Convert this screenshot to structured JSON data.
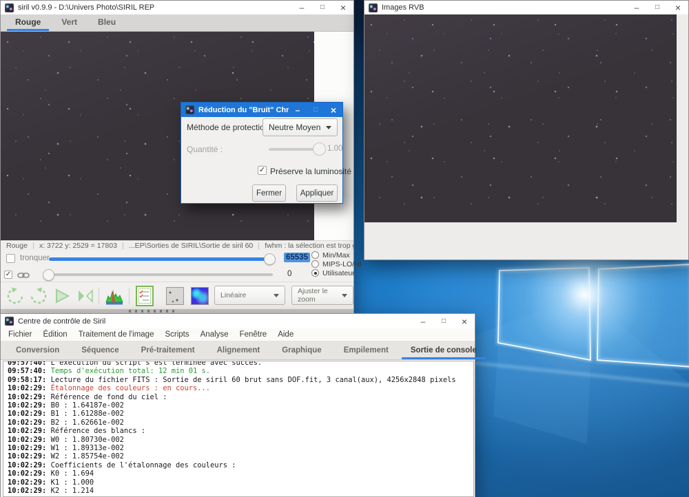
{
  "glyphs": {
    "minimize": "–",
    "maximize": "□",
    "close": "×",
    "check": "✓"
  },
  "colors": {
    "accent": "#3584e4",
    "dialog_titlebar": "#1f76d8",
    "selection": "#4f94e0",
    "console_green": "#2d9b34",
    "console_red": "#c8432e"
  },
  "main_window": {
    "title": "siril v0.9.9 - D:\\Univers Photo\\SIRIL REP",
    "tabs": [
      {
        "label": "Rouge",
        "active": true
      },
      {
        "label": "Vert",
        "active": false
      },
      {
        "label": "Bleu",
        "active": false
      }
    ],
    "statusbar": {
      "channel": "Rouge",
      "coords": "x: 3722 y: 2529 = 17803",
      "path": "...EP\\Sorties de SIRIL\\Sortie de siril 60",
      "fwhm": "fwhm : la sélection est trop grande"
    },
    "levels": {
      "truncate_label": "tronquer",
      "high_value": "65535",
      "low_value": "0",
      "modes": [
        "Min/Max",
        "MIPS-LO/HI",
        "Utilisateur"
      ],
      "selected_mode": "Utilisateur"
    },
    "toolbar": {
      "display_mode": "Linéaire",
      "zoom_label": "Ajuster le zoom",
      "icons": [
        "rotate-ccw-icon",
        "rotate-cw-icon",
        "play-icon",
        "flip-horizontal-icon",
        "histogram-icon",
        "journal-icon",
        "grayscale-preview-icon",
        "color-preview-icon"
      ]
    }
  },
  "rvb_window": {
    "title": "Images RVB"
  },
  "noise_dialog": {
    "title": "Réduction du \"Bruit\" Chrom...",
    "method_label": "Méthode de protection :",
    "method_value": "Neutre Moyen",
    "amount_label": "Quantité :",
    "amount_value": "1.00",
    "preserve_label": "Préserve la luminosité",
    "preserve_checked": true,
    "close_button": "Fermer",
    "apply_button": "Appliquer"
  },
  "control_window": {
    "title": "Centre de contrôle de Siril",
    "menus": [
      "Fichier",
      "Édition",
      "Traitement de l'image",
      "Scripts",
      "Analyse",
      "Fenêtre",
      "Aide"
    ],
    "tabs": [
      "Conversion",
      "Séquence",
      "Pré-traitement",
      "Alignement",
      "Graphique",
      "Empilement",
      "Sortie de console"
    ],
    "active_tab": "Sortie de console",
    "console": [
      {
        "time": "09:57:40:",
        "text": "L'exécution du script s'est terminée avec succès.",
        "color": "default"
      },
      {
        "time": "09:57:40:",
        "text": "Temps d'exécution total: 12 min 01 s.",
        "color": "green"
      },
      {
        "time": "09:58:17:",
        "text": "Lecture du fichier FITS : Sortie de siril 60 brut sans DOF.fit, 3 canal(aux), 4256x2848 pixels",
        "color": "default"
      },
      {
        "time": "10:02:29:",
        "text": "Étalonnage des couleurs : en cours...",
        "color": "red"
      },
      {
        "time": "10:02:29:",
        "text": "Référence de fond du ciel :",
        "color": "default"
      },
      {
        "time": "10:02:29:",
        "text": "B0 : 1.64187e-002",
        "color": "default"
      },
      {
        "time": "10:02:29:",
        "text": "B1 : 1.61288e-002",
        "color": "default"
      },
      {
        "time": "10:02:29:",
        "text": "B2 : 1.62661e-002",
        "color": "default"
      },
      {
        "time": "10:02:29:",
        "text": "Référence des blancs :",
        "color": "default"
      },
      {
        "time": "10:02:29:",
        "text": "W0 : 1.80730e-002",
        "color": "default"
      },
      {
        "time": "10:02:29:",
        "text": "W1 : 1.89313e-002",
        "color": "default"
      },
      {
        "time": "10:02:29:",
        "text": "W2 : 1.85754e-002",
        "color": "default"
      },
      {
        "time": "10:02:29:",
        "text": "Coefficients de l'étalonnage des couleurs :",
        "color": "default"
      },
      {
        "time": "10:02:29:",
        "text": "K0 : 1.694",
        "color": "default"
      },
      {
        "time": "10:02:29:",
        "text": "K1 : 1.000",
        "color": "default"
      },
      {
        "time": "10:02:29:",
        "text": "K2 : 1.214",
        "color": "default"
      }
    ]
  }
}
